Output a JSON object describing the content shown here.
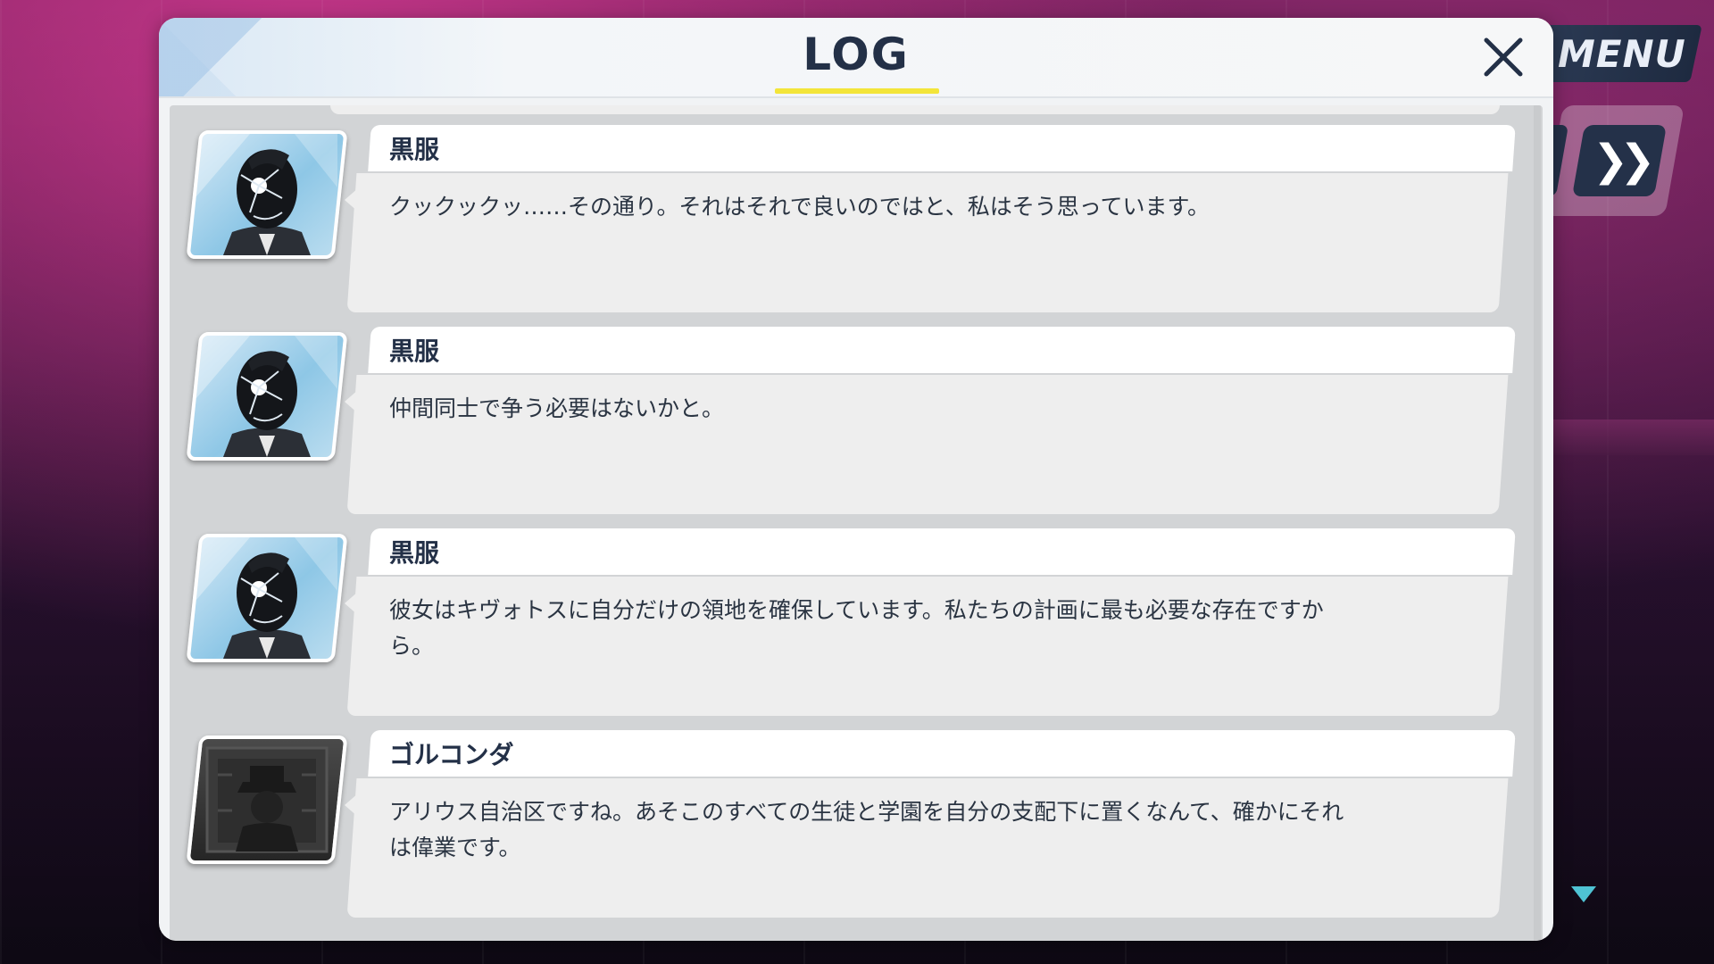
{
  "header": {
    "title": "LOG"
  },
  "overlay": {
    "menu_label": "MENU",
    "fast_forward_icon": "double-chevron-right-icon"
  },
  "entries": [
    {
      "speaker": "黒服",
      "portrait": "black-suit-portrait",
      "text": "クックックッ……その通り。それはそれで良いのではと、私はそう思っています。"
    },
    {
      "speaker": "黒服",
      "portrait": "black-suit-portrait",
      "text": "仲間同士で争う必要はないかと。"
    },
    {
      "speaker": "黒服",
      "portrait": "black-suit-portrait",
      "text": "彼女はキヴォトスに自分だけの領地を確保しています。私たちの計画に最も必要な存在ですから。"
    },
    {
      "speaker": "ゴルコンダ",
      "portrait": "golconda-portrait",
      "text": "アリウス自治区ですね。あそこのすべての生徒と学園を自分の支配下に置くなんて、確かにそれは偉業です。"
    }
  ],
  "colors": {
    "title": "#233047",
    "accent_underline": "#f3e53a",
    "text": "#2a3442"
  }
}
